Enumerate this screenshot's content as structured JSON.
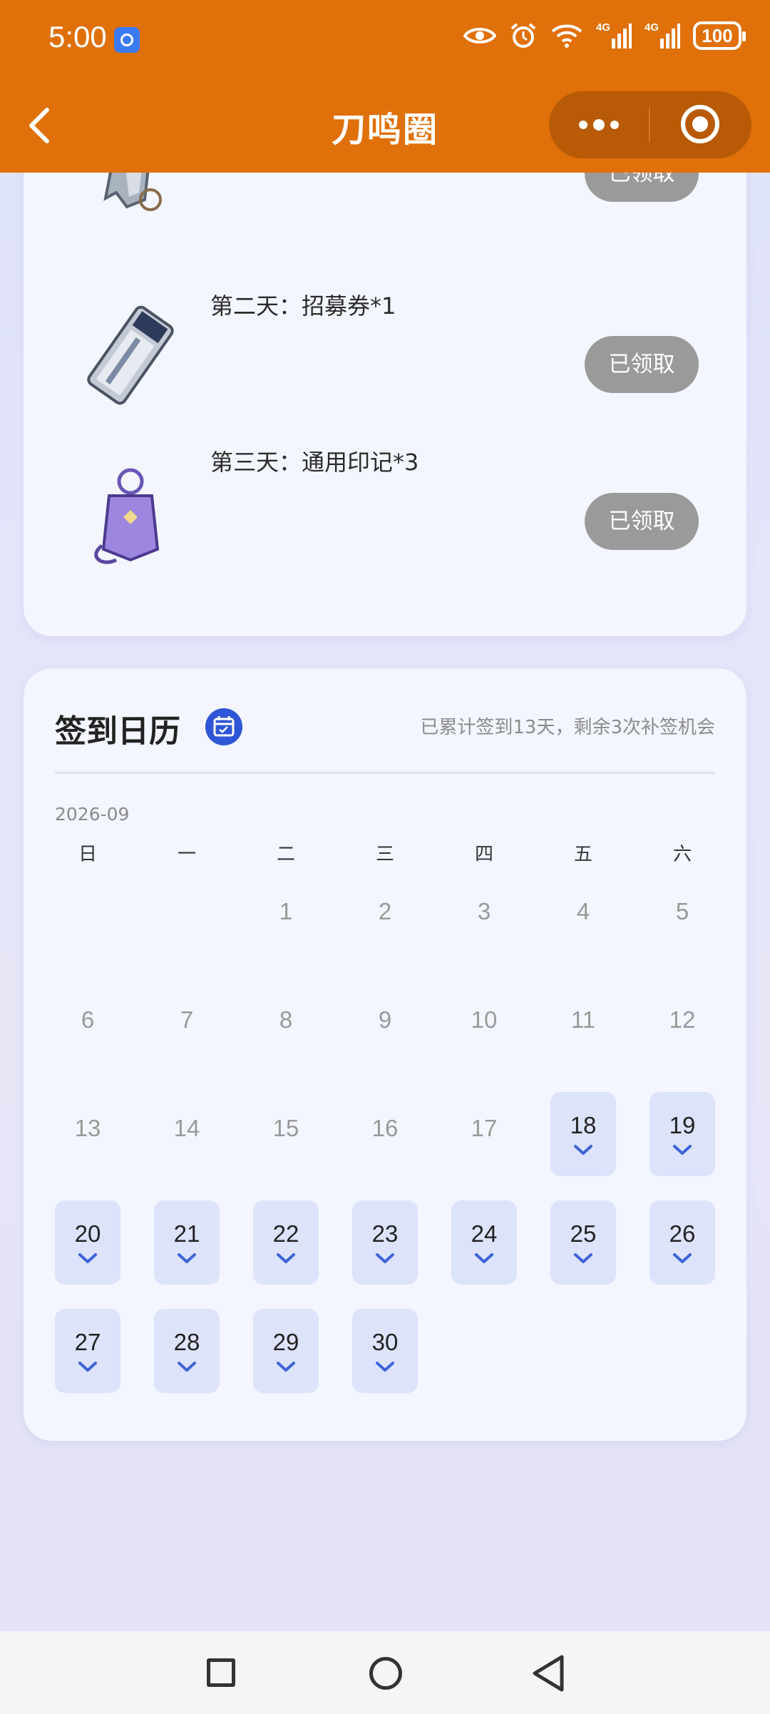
{
  "status_bar": {
    "time": "5:00",
    "battery": "100",
    "network_1": "4G",
    "network_2": "4G",
    "icons": [
      "eye-icon",
      "alarm-icon",
      "wifi-icon",
      "signal-icon",
      "signal-icon",
      "battery-icon"
    ]
  },
  "header": {
    "title": "刀鸣圈",
    "accent_color": "#e0700a"
  },
  "rewards": {
    "items": [
      {
        "label": "",
        "button": "已领取",
        "icon": "key-tag-icon"
      },
      {
        "label": "第二天：招募券*1",
        "button": "已领取",
        "icon": "ticket-icon"
      },
      {
        "label": "第三天：通用印记*3",
        "button": "已领取",
        "icon": "amulet-icon"
      }
    ]
  },
  "calendar": {
    "title": "签到日历",
    "summary": "已累计签到13天，剩余3次补签机会",
    "month": "2026-09",
    "weekdays": [
      "日",
      "一",
      "二",
      "三",
      "四",
      "五",
      "六"
    ],
    "days": [
      "1",
      "2",
      "3",
      "4",
      "5",
      "6",
      "7",
      "8",
      "9",
      "10",
      "11",
      "12",
      "13",
      "14",
      "15",
      "16",
      "17",
      "18",
      "19",
      "20",
      "21",
      "22",
      "23",
      "24",
      "25",
      "26",
      "27",
      "28",
      "29",
      "30"
    ],
    "first_weekday_index": 2,
    "signed_days": [
      18,
      19,
      20,
      21,
      22,
      23,
      24,
      25,
      26,
      27,
      28,
      29,
      30
    ],
    "signed_color": "#dce3fb",
    "check_color": "#3f63d8"
  }
}
